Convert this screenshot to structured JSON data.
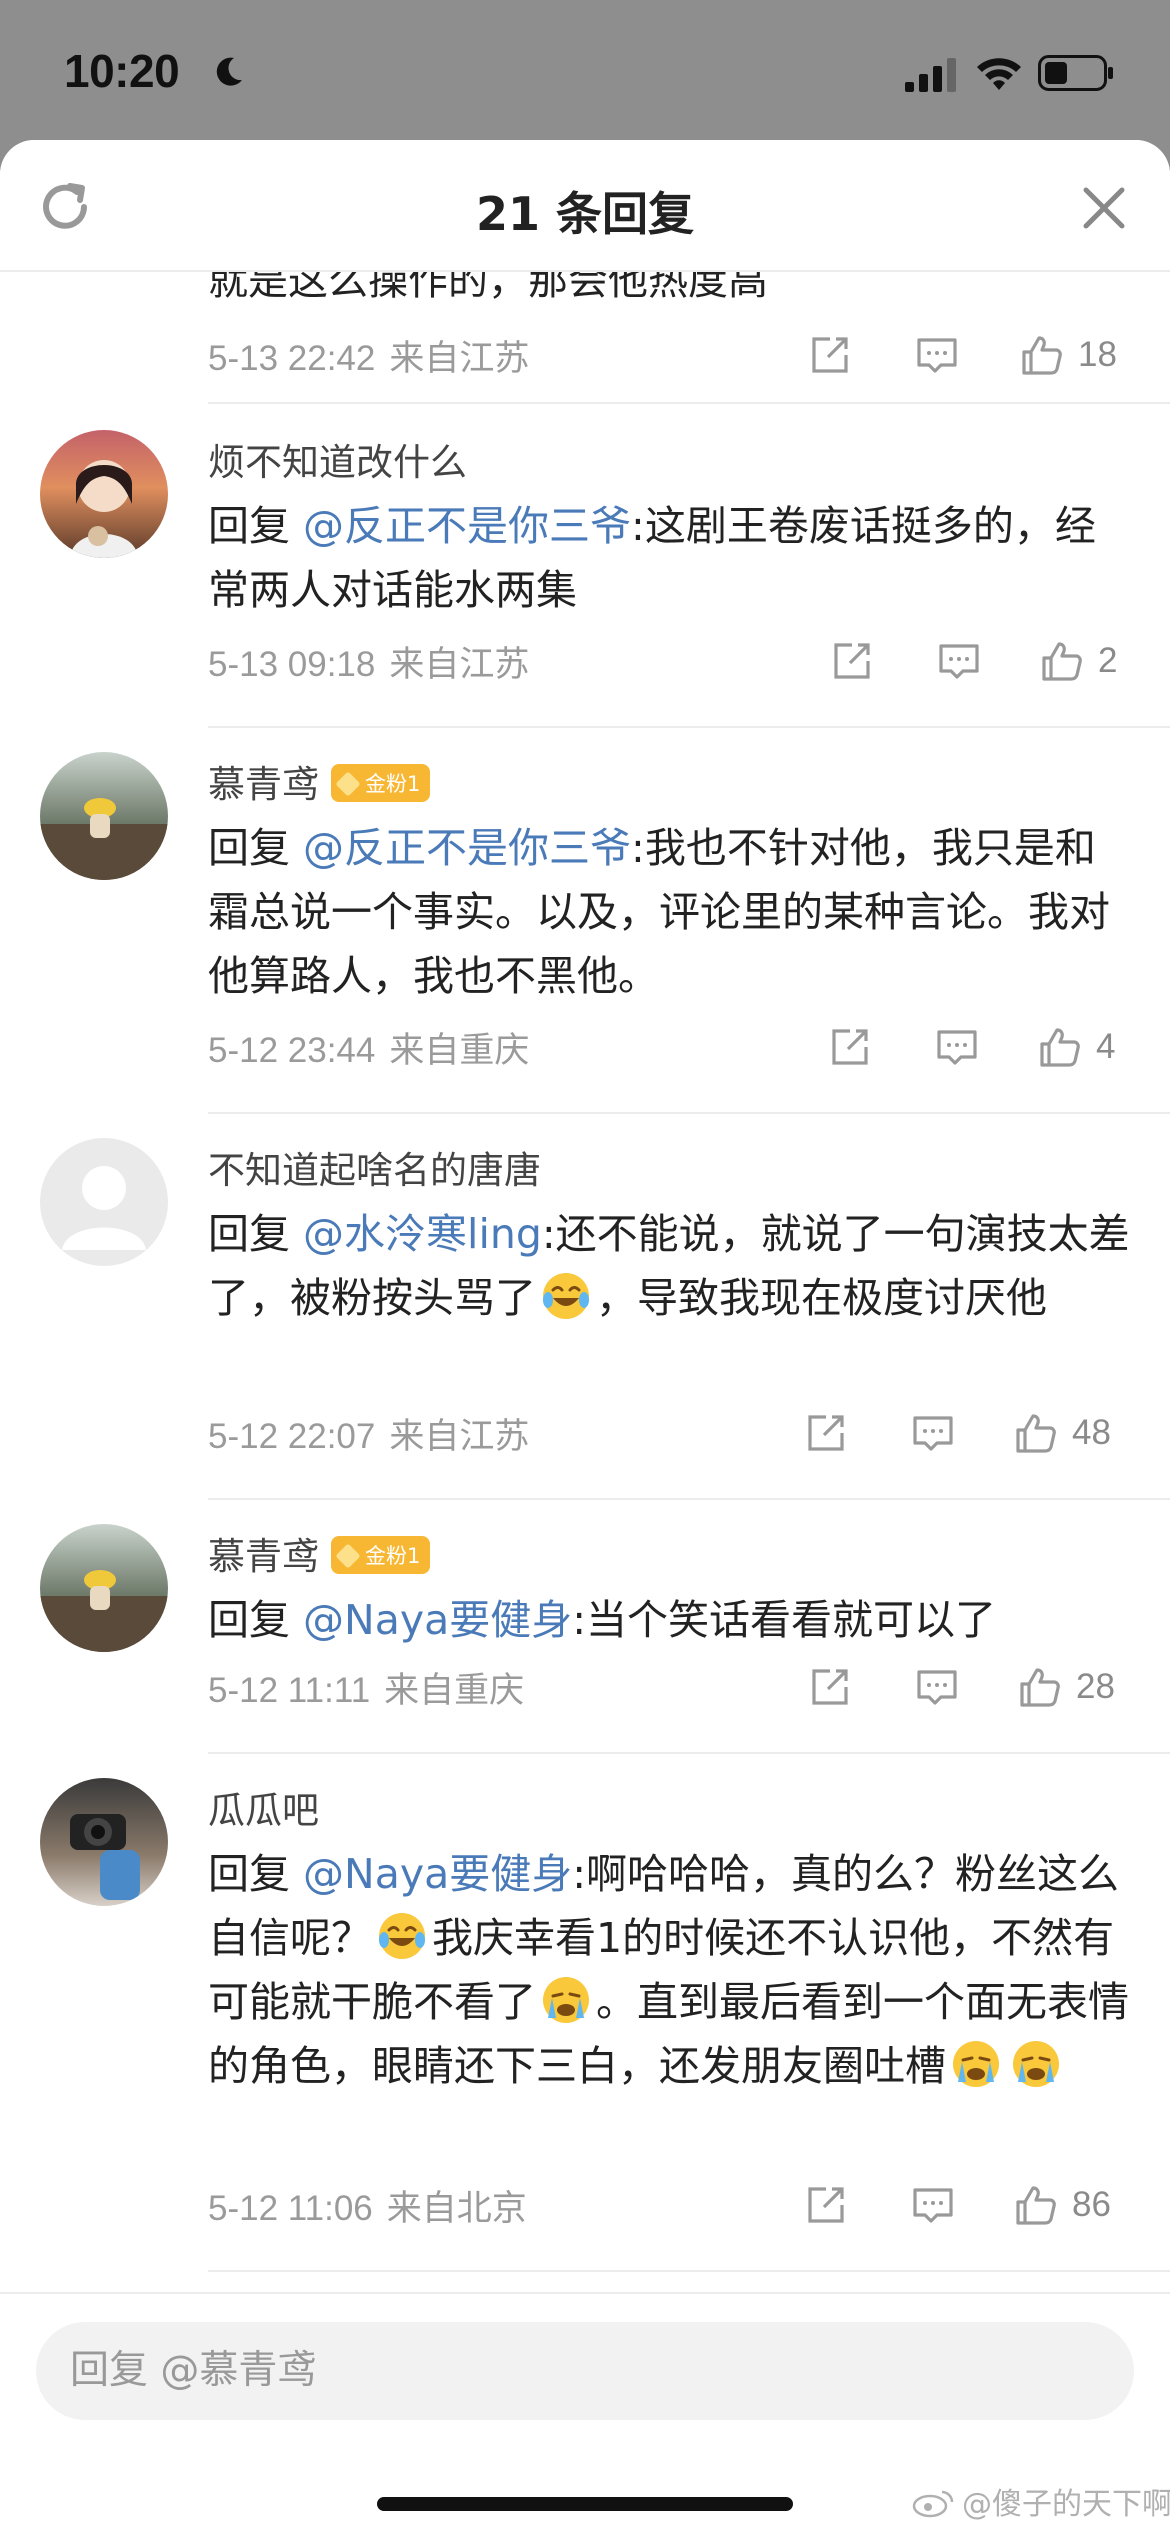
{
  "status_bar": {
    "time": "10:20"
  },
  "header": {
    "title": "21 条回复"
  },
  "partial_comment": {
    "text_tail": "就是这么操作的，那会他热度高",
    "date": "5-13 22:42",
    "source": "来自江苏",
    "likes": "18"
  },
  "comments": [
    {
      "user": "烦不知道改什么",
      "badge": "",
      "reply_prefix": "回复",
      "mention": "@反正不是你三爷",
      "text": ":这剧王卷废话挺多的，经常两人对话能水两集",
      "date": "5-13 09:18",
      "source": "来自江苏",
      "likes": "2"
    },
    {
      "user": "慕青鸢",
      "badge": "金粉1",
      "reply_prefix": "回复",
      "mention": "@反正不是你三爷",
      "text": ":我也不针对他，我只是和霜总说一个事实。以及，评论里的某种言论。我对他算路人，我也不黑他。",
      "date": "5-12 23:44",
      "source": "来自重庆",
      "likes": "4"
    },
    {
      "user": "不知道起啥名的唐唐",
      "badge": "",
      "reply_prefix": "回复",
      "mention": "@水泠寒ling",
      "text_a": ":还不能说，就说了一句演技太差了，被粉按头骂了",
      "text_b": "，导致我现在极度讨厌他",
      "date": "5-12 22:07",
      "source": "来自江苏",
      "likes": "48"
    },
    {
      "user": "慕青鸢",
      "badge": "金粉1",
      "reply_prefix": "回复",
      "mention": "@Naya要健身",
      "text": ":当个笑话看看就可以了",
      "date": "5-12 11:11",
      "source": "来自重庆",
      "likes": "28"
    },
    {
      "user": "瓜瓜吧",
      "badge": "",
      "reply_prefix": "回复",
      "mention": "@Naya要健身",
      "text_a": ":啊哈哈哈，真的么？粉丝这么自信呢？",
      "text_b": "我庆幸看1的时候还不认识他，不然有可能就干脆不看了",
      "text_c": "。直到最后看到一个面无表情的角色，眼睛还下三白，还发朋友圈吐槽",
      "date": "5-12 11:06",
      "source": "来自北京",
      "likes": "86"
    }
  ],
  "compose": {
    "placeholder": "回复 @慕青鸢"
  },
  "watermark": "@傻子的天下啊"
}
